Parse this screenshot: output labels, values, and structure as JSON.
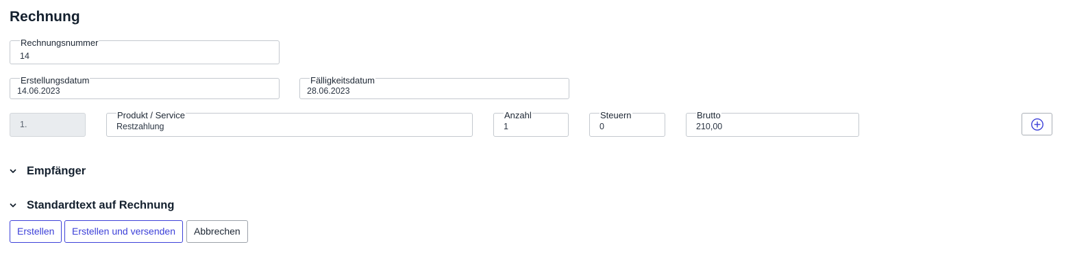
{
  "page": {
    "title": "Rechnung"
  },
  "fields": {
    "invoice_number": {
      "label": "Rechnungsnummer",
      "value": "14"
    },
    "created_date": {
      "label": "Erstellungsdatum",
      "value": "14.06.2023"
    },
    "due_date": {
      "label": "Fälligkeitsdatum",
      "value": "28.06.2023"
    }
  },
  "line_item": {
    "position": "1.",
    "product": {
      "label": "Produkt / Service",
      "value": "Restzahlung"
    },
    "quantity": {
      "label": "Anzahl",
      "value": "1"
    },
    "tax": {
      "label": "Steuern",
      "value": "0"
    },
    "gross": {
      "label": "Brutto",
      "value": "210,00"
    },
    "add_icon": "plus-circle-icon"
  },
  "sections": [
    {
      "title": "Empfänger",
      "icon": "chevron-down-icon"
    },
    {
      "title": "Standardtext auf Rechnung",
      "icon": "chevron-down-icon"
    }
  ],
  "actions": {
    "create_label": "Erstellen",
    "create_send_label": "Erstellen und versenden",
    "cancel_label": "Abbrechen"
  },
  "colors": {
    "accent": "#3b3fd8",
    "text": "#14202e",
    "border": "#c3c8ce",
    "disabled_bg": "#e9ecef"
  }
}
